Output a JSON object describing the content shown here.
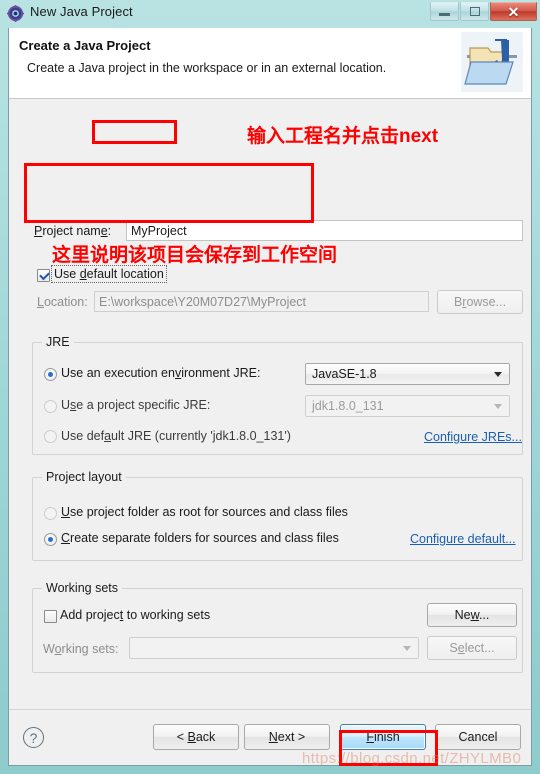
{
  "window": {
    "title": "New Java Project",
    "icon": "java-project-gear-icon",
    "caption_buttons": {
      "minimize": "minimize-icon",
      "maximize": "maximize-icon",
      "close": "✕"
    }
  },
  "header": {
    "title": "Create a Java Project",
    "subtitle": "Create a Java project in the workspace or in an external location.",
    "icon": "java-folder-icon"
  },
  "project_name": {
    "label_pre": "P",
    "label_mid": "roject nam",
    "label_post": "e:",
    "label_full": "Project name:",
    "value": "MyProject"
  },
  "location": {
    "use_default_label_pre": "Use ",
    "use_default_label_mid": "d",
    "use_default_label_post": "efault location",
    "use_default_label": "Use default location",
    "use_default_checked": true,
    "location_label": "Location:",
    "location_value": "E:\\workspace\\Y20M07D27\\MyProject",
    "browse_label": "Browse...",
    "browse_enabled": false
  },
  "jre": {
    "group_title": "JRE",
    "options": [
      {
        "label": "Use an execution environment JRE:",
        "selected": true,
        "enabled": true
      },
      {
        "label": "Use a project specific JRE:",
        "selected": false,
        "enabled": false
      },
      {
        "label": "Use default JRE (currently 'jdk1.8.0_131')",
        "selected": false,
        "enabled": false
      }
    ],
    "execution_env_value": "JavaSE-1.8",
    "specific_jre_value": "jdk1.8.0_131",
    "configure_link": "Configure JREs..."
  },
  "project_layout": {
    "group_title": "Project layout",
    "options": [
      {
        "label": "Use project folder as root for sources and class files",
        "selected": false
      },
      {
        "label": "Create separate folders for sources and class files",
        "selected": true
      }
    ],
    "configure_link": "Configure default..."
  },
  "working_sets": {
    "group_title": "Working sets",
    "add_label": "Add project to working sets",
    "add_checked": false,
    "new_label": "New...",
    "sets_label": "Working sets:",
    "sets_value": "",
    "select_label": "Select...",
    "select_enabled": false
  },
  "footer": {
    "help_icon": "?",
    "back_label": "< Back",
    "next_label": "Next >",
    "finish_label": "Finish",
    "cancel_label": "Cancel"
  },
  "annotations": {
    "note_project_name": "输入工程名并点击next",
    "note_workspace": "这里说明该项目会保存到工作空间",
    "color": "#fe0000"
  },
  "watermark": {
    "text": "https://blog.csdn.net/ZHYLMB0"
  }
}
